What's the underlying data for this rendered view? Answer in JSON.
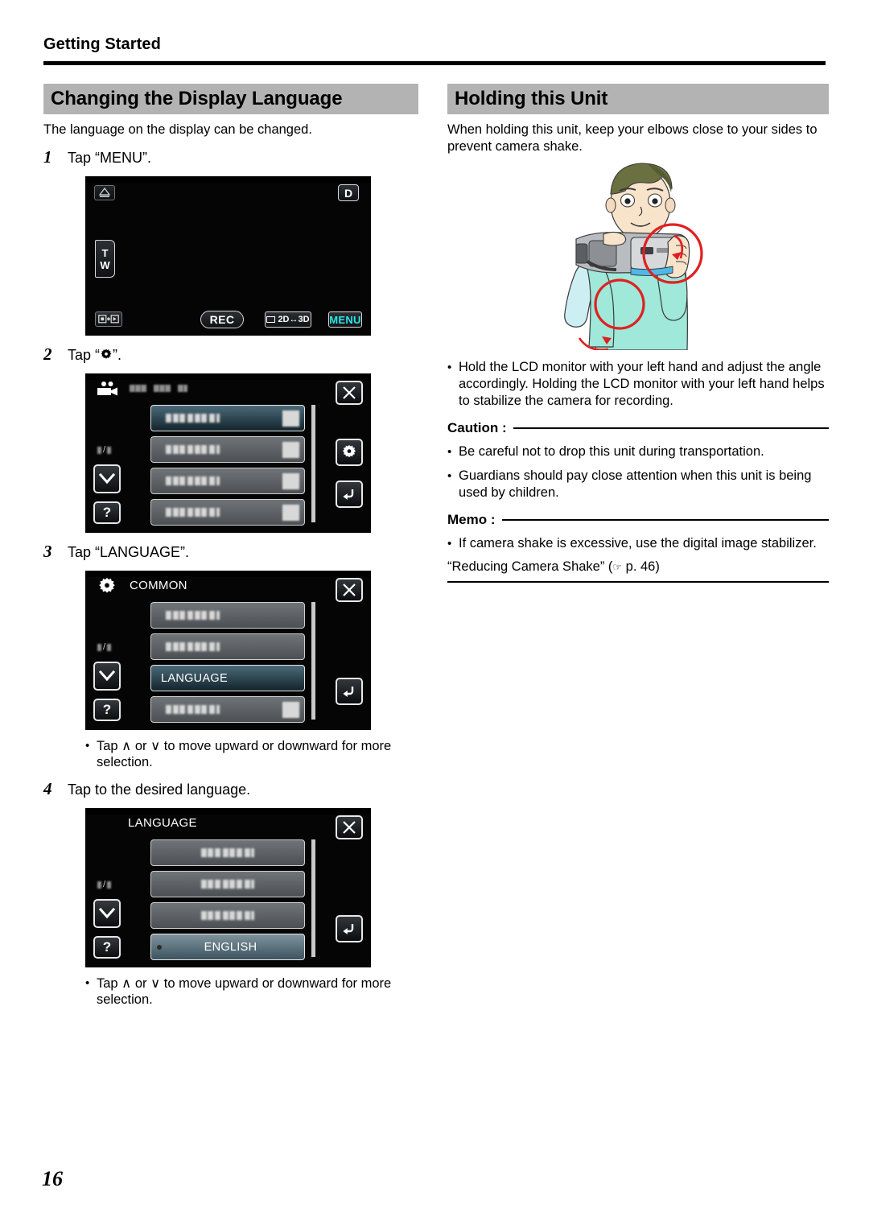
{
  "running_head": "Getting Started",
  "page_number": "16",
  "left": {
    "banner_title": "Changing the Display Language",
    "intro": "The language on the display can be changed.",
    "steps": [
      {
        "num": "1",
        "text_before": "Tap “MENU”.",
        "icon": null,
        "text_after": ""
      },
      {
        "num": "2",
        "text_before": "Tap “",
        "icon": "gear-icon",
        "text_after": "”."
      },
      {
        "num": "3",
        "text_before": "Tap “LANGUAGE”.",
        "icon": null,
        "text_after": ""
      },
      {
        "num": "4",
        "text_before": "Tap to the desired language.",
        "icon": null,
        "text_after": ""
      }
    ],
    "note_bullet": "•",
    "note_text": "Tap ∧ or ∨ to move upward or downward for more selection."
  },
  "screen1": {
    "name": "record-standby-screen",
    "icon_top_left": "scene-select-icon",
    "badge_d": "D",
    "zoom_t": "T",
    "zoom_w": "W",
    "icon_bottom_left": "mode-switch-icon",
    "rec_label": "REC",
    "twod_threed_label": "2D↔3D",
    "menu_label": "MENU"
  },
  "screen2": {
    "name": "video-menu-screen",
    "title_icon": "video-camera-icon",
    "title": "",
    "page_indicator": "",
    "close_label": "✕",
    "gear_label": "gear-icon",
    "back_label": "back-icon",
    "down_label": "chevron-down-icon",
    "help_label": "?",
    "rows": [
      {
        "label": "",
        "selected": true,
        "thumb": true
      },
      {
        "label": "",
        "selected": false,
        "thumb": true
      },
      {
        "label": "",
        "selected": false,
        "thumb": true
      },
      {
        "label": "",
        "selected": false,
        "thumb": true
      }
    ]
  },
  "screen3": {
    "name": "common-settings-screen",
    "title_icon": "gear-icon",
    "title": "COMMON",
    "close_label": "✕",
    "back_label": "back-icon",
    "down_label": "chevron-down-icon",
    "help_label": "?",
    "rows": [
      {
        "label": "",
        "selected": false,
        "thumb": false
      },
      {
        "label": "",
        "selected": false,
        "thumb": false
      },
      {
        "label": "LANGUAGE",
        "selected": true,
        "thumb": false
      },
      {
        "label": "",
        "selected": false,
        "thumb": true
      }
    ]
  },
  "screen4": {
    "name": "language-select-screen",
    "title": "LANGUAGE",
    "close_label": "✕",
    "back_label": "back-icon",
    "down_label": "chevron-down-icon",
    "help_label": "?",
    "rows": [
      {
        "label": "",
        "selected": false,
        "thumb": false
      },
      {
        "label": "",
        "selected": false,
        "thumb": false
      },
      {
        "label": "",
        "selected": false,
        "thumb": false
      },
      {
        "label": "ENGLISH",
        "selected": true,
        "thumb": false
      }
    ]
  },
  "right": {
    "banner_title": "Holding this Unit",
    "intro": "When holding this unit, keep your elbows close to your sides to prevent camera shake.",
    "illustration": "person-holding-camcorder-illustration",
    "bullet": "•",
    "hold_note": "Hold the LCD monitor with your left hand and adjust the angle accordingly. Holding the LCD monitor with your left hand helps to stabilize the camera for recording.",
    "caution_label": "Caution :",
    "caution_items": [
      "Be careful not to drop this unit during transportation.",
      "Guardians should pay close attention when this unit is being used by children."
    ],
    "memo_label": "Memo :",
    "memo_items": [
      "If camera shake is excessive, use the digital image stabilizer."
    ],
    "xref_text": "“Reducing Camera Shake” (",
    "xref_hand": "☞",
    "xref_page": " p. 46)"
  },
  "colors": {
    "banner_bg": "#b3b3b3",
    "lcd_bg": "#050505",
    "menu_accent": "#2ee6e6",
    "selected_row": "#2f4a57",
    "annotation_red": "#e02020",
    "shirt": "#9fe8da"
  }
}
